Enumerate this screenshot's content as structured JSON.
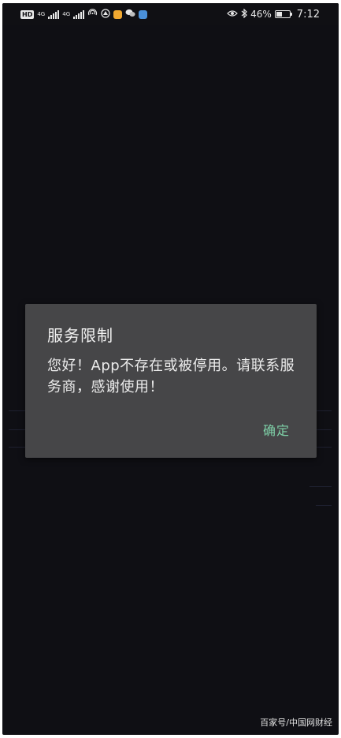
{
  "status_bar": {
    "hd_label": "HD",
    "net_label_1": "4G",
    "net_label_2": "4G",
    "battery_percent_text": "46%",
    "battery_level": 0.46,
    "time": "7:12",
    "icons": [
      "hd-icon",
      "signal-icon",
      "signal-icon",
      "hotspot-icon",
      "location-icon",
      "app-notification-icon",
      "wechat-icon",
      "browser-icon",
      "eye-comfort-icon",
      "bluetooth-icon",
      "battery-icon"
    ]
  },
  "dialog": {
    "title": "服务限制",
    "message": "您好！App不存在或被停用。请联系服务商，感谢使用！",
    "confirm_label": "确定"
  },
  "watermark": {
    "text": "百家号/中国网财经"
  },
  "colors": {
    "background": "#0f0f14",
    "dialog_background": "#464648",
    "accent": "#7fd1a8"
  }
}
